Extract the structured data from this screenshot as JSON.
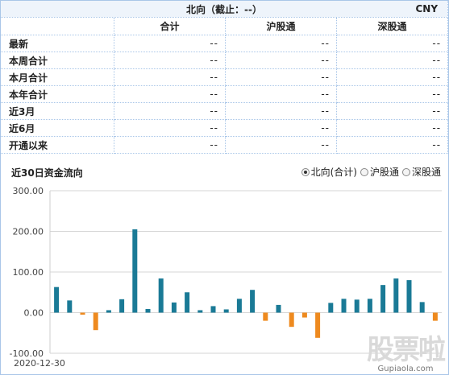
{
  "header": {
    "title": "北向（截止：--）",
    "currency": "CNY"
  },
  "columns": [
    "合计",
    "沪股通",
    "深股通"
  ],
  "rows": [
    {
      "label": "最新",
      "values": [
        "--",
        "--",
        "--"
      ]
    },
    {
      "label": "本周合计",
      "values": [
        "--",
        "--",
        "--"
      ]
    },
    {
      "label": "本月合计",
      "values": [
        "--",
        "--",
        "--"
      ]
    },
    {
      "label": "本年合计",
      "values": [
        "--",
        "--",
        "--"
      ]
    },
    {
      "label": "近3月",
      "values": [
        "--",
        "--",
        "--"
      ]
    },
    {
      "label": "近6月",
      "values": [
        "--",
        "--",
        "--"
      ]
    },
    {
      "label": "开通以来",
      "values": [
        "--",
        "--",
        "--"
      ]
    }
  ],
  "flow": {
    "title": "近30日资金流向",
    "options": [
      {
        "label": "北向(合计)",
        "selected": true
      },
      {
        "label": "沪股通",
        "selected": false
      },
      {
        "label": "深股通",
        "selected": false
      }
    ]
  },
  "watermark": {
    "logo": "股票啦",
    "url": "Gupiaola.com"
  },
  "colors": {
    "positive": "#1a7a96",
    "negative": "#ee8a1f",
    "border": "#a9c6e8",
    "grid": "#d6d6d6"
  },
  "chart_data": {
    "type": "bar",
    "ylim": [
      -100,
      300
    ],
    "yticks": [
      "300.00",
      "200.00",
      "100.00",
      "0.00",
      "-100.00"
    ],
    "ytick_values": [
      300,
      200,
      100,
      0,
      -100
    ],
    "x_first_label": "2020-12-30",
    "values": [
      63,
      30,
      -5,
      -43,
      6,
      33,
      205,
      9,
      84,
      25,
      50,
      6,
      16,
      8,
      34,
      56,
      -20,
      19,
      -35,
      -12,
      -62,
      24,
      34,
      32,
      34,
      68,
      84,
      80,
      26,
      -20
    ]
  }
}
